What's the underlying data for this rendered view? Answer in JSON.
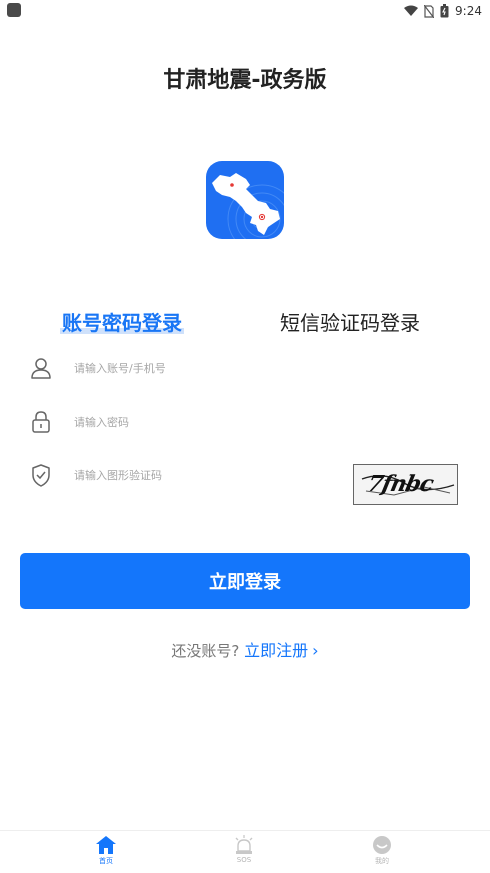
{
  "status_bar": {
    "time": "9:24"
  },
  "app": {
    "title": "甘肃地震-政务版"
  },
  "login_tabs": [
    {
      "label": "账号密码登录",
      "active": true
    },
    {
      "label": "短信验证码登录",
      "active": false
    }
  ],
  "form": {
    "account": {
      "placeholder": "请输入账号/手机号",
      "value": "",
      "icon": "user-icon"
    },
    "password": {
      "placeholder": "请输入密码",
      "value": "",
      "icon": "lock-icon"
    },
    "captcha": {
      "placeholder": "请输入图形验证码",
      "value": "",
      "icon": "shield-check-icon",
      "image_text": "7fnbc"
    }
  },
  "login_button": {
    "label": "立即登录"
  },
  "register": {
    "question": "还没账号?",
    "link": "立即注册"
  },
  "bottom_nav": [
    {
      "label": "首页",
      "icon": "home-icon",
      "active": true
    },
    {
      "label": "SOS",
      "icon": "alarm-icon",
      "active": false
    },
    {
      "label": "我的",
      "icon": "smile-icon",
      "active": false
    }
  ],
  "colors": {
    "primary": "#1476fb",
    "tab_highlight": "#cfe1fb",
    "logo_bg": "#1f6ff2"
  }
}
